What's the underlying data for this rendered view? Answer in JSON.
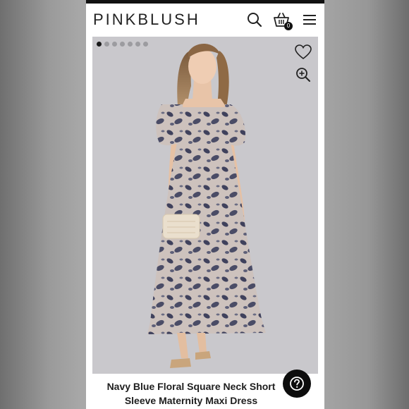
{
  "header": {
    "brand": "PINKBLUSH",
    "cart_count": "0"
  },
  "icons": {
    "search": "search-icon",
    "cart": "shopping-basket-icon",
    "menu": "hamburger-menu-icon",
    "favorite": "heart-icon",
    "zoom": "zoom-in-icon",
    "help": "question-mark-icon"
  },
  "carousel": {
    "total_images": 7,
    "active_index": 0
  },
  "product": {
    "title_line1": "Navy Blue Floral Square Neck Short",
    "title_line2": "Sleeve Maternity Maxi Dress"
  },
  "colors": {
    "brand_text": "#222222",
    "image_background": "#c9c8cc",
    "dress_base": "#c8bdb8",
    "dress_print": "#3d3f5a",
    "help_button": "#0d0d0d"
  }
}
